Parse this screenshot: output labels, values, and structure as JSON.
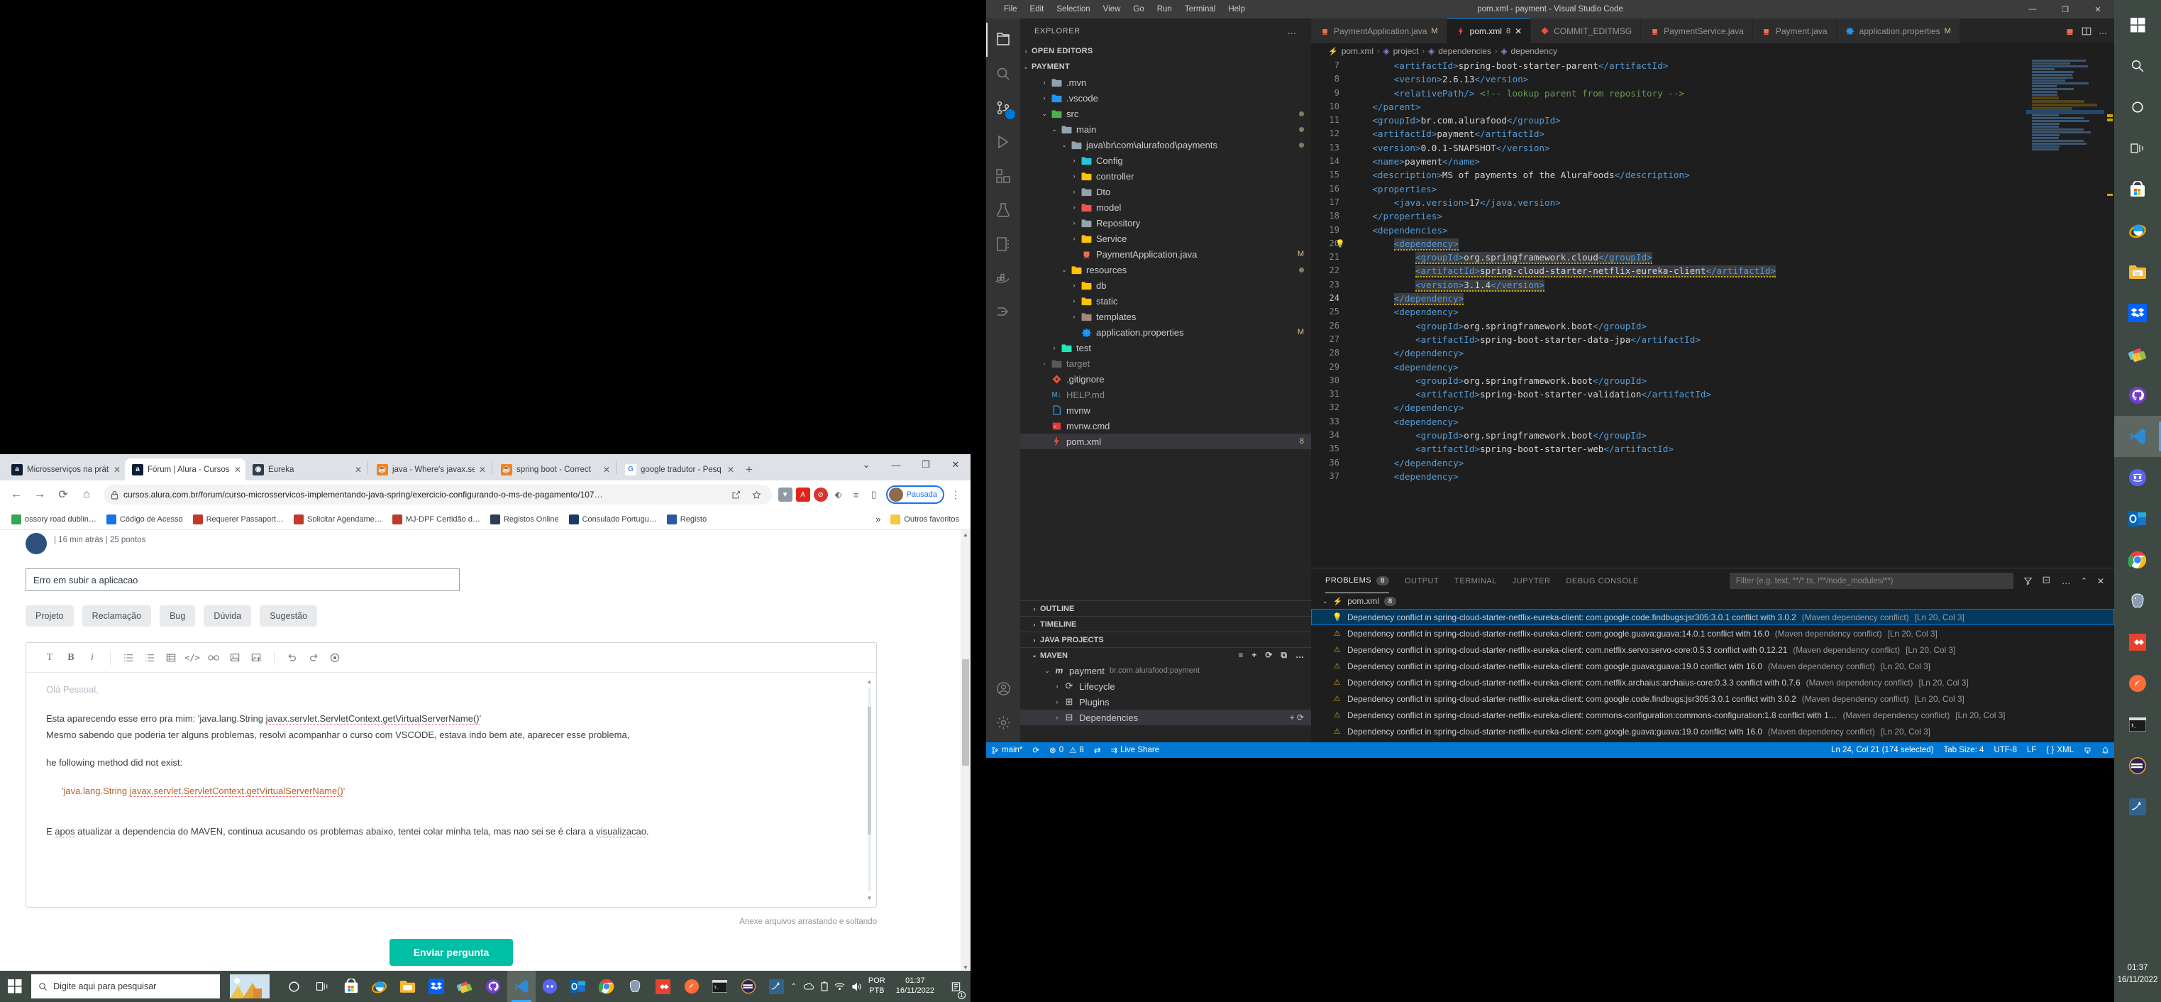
{
  "vscode": {
    "window_title": "pom.xml - payment - Visual Studio Code",
    "menu": [
      "File",
      "Edit",
      "Selection",
      "View",
      "Go",
      "Run",
      "Terminal",
      "Help"
    ],
    "window_controls": {
      "minimize": "—",
      "maximize": "❐",
      "close": "✕"
    },
    "sidebar": {
      "header": "EXPLORER",
      "header_more": "…",
      "open_editors": "OPEN EDITORS",
      "project_name": "PAYMENT",
      "tree": [
        {
          "label": ".mvn",
          "depth": 1,
          "arrow": "›",
          "icon": "folder",
          "color": "#90a4ae",
          "badge": ""
        },
        {
          "label": ".vscode",
          "depth": 1,
          "arrow": "›",
          "icon": "folder-vscode",
          "color": "#2196f3",
          "badge": ""
        },
        {
          "label": "src",
          "depth": 1,
          "arrow": "⌄",
          "icon": "folder-src",
          "color": "#4caf50",
          "badge": "dot"
        },
        {
          "label": "main",
          "depth": 2,
          "arrow": "⌄",
          "icon": "folder-open",
          "color": "#90a4ae",
          "badge": "dot"
        },
        {
          "label": "java\\br\\com\\alurafood\\payments",
          "depth": 3,
          "arrow": "⌄",
          "icon": "folder-open",
          "color": "#90a4ae",
          "badge": "dot"
        },
        {
          "label": "Config",
          "depth": 4,
          "arrow": "›",
          "icon": "folder-gear",
          "color": "#26c6da",
          "badge": ""
        },
        {
          "label": "controller",
          "depth": 4,
          "arrow": "›",
          "icon": "folder-gear",
          "color": "#ffc107",
          "badge": ""
        },
        {
          "label": "Dto",
          "depth": 4,
          "arrow": "›",
          "icon": "folder",
          "color": "#90a4ae",
          "badge": ""
        },
        {
          "label": "model",
          "depth": 4,
          "arrow": "›",
          "icon": "folder-db",
          "color": "#ef5350",
          "badge": ""
        },
        {
          "label": "Repository",
          "depth": 4,
          "arrow": "›",
          "icon": "folder",
          "color": "#90a4ae",
          "badge": ""
        },
        {
          "label": "Service",
          "depth": 4,
          "arrow": "›",
          "icon": "folder-gear",
          "color": "#ffc107",
          "badge": ""
        },
        {
          "label": "PaymentApplication.java",
          "depth": 4,
          "arrow": "",
          "icon": "java",
          "color": "#e76f51",
          "badge": "M"
        },
        {
          "label": "resources",
          "depth": 3,
          "arrow": "⌄",
          "icon": "folder-res",
          "color": "#ffc107",
          "badge": "dot"
        },
        {
          "label": "db",
          "depth": 4,
          "arrow": "›",
          "icon": "folder-res",
          "color": "#ffc107",
          "badge": ""
        },
        {
          "label": "static",
          "depth": 4,
          "arrow": "›",
          "icon": "folder-res",
          "color": "#ffc107",
          "badge": ""
        },
        {
          "label": "templates",
          "depth": 4,
          "arrow": "›",
          "icon": "folder-res",
          "color": "#a1887f",
          "badge": ""
        },
        {
          "label": "application.properties",
          "depth": 4,
          "arrow": "",
          "icon": "gear",
          "color": "#2196f3",
          "badge": "M"
        },
        {
          "label": "test",
          "depth": 2,
          "arrow": "›",
          "icon": "folder-test",
          "color": "#1de9b6",
          "badge": ""
        },
        {
          "label": "target",
          "depth": 1,
          "arrow": "›",
          "icon": "folder-dim",
          "color": "#6e7b82",
          "badge": ""
        },
        {
          "label": ".gitignore",
          "depth": 1,
          "arrow": "",
          "icon": "git",
          "color": "#f05033",
          "badge": ""
        },
        {
          "label": "HELP.md",
          "depth": 1,
          "arrow": "",
          "icon": "md",
          "color": "#4fc3f7",
          "badge": ""
        },
        {
          "label": "mvnw",
          "depth": 1,
          "arrow": "",
          "icon": "file",
          "color": "#42a5f5",
          "badge": ""
        },
        {
          "label": "mvnw.cmd",
          "depth": 1,
          "arrow": "",
          "icon": "cmd",
          "color": "#e53935",
          "badge": ""
        },
        {
          "label": "pom.xml",
          "depth": 1,
          "arrow": "",
          "icon": "pom",
          "color": "#e74c3c",
          "badge": "8",
          "selected": true
        }
      ],
      "sections": [
        {
          "label": "OUTLINE",
          "arrow": "›"
        },
        {
          "label": "TIMELINE",
          "arrow": "›"
        },
        {
          "label": "JAVA PROJECTS",
          "arrow": "›"
        },
        {
          "label": "MAVEN",
          "arrow": "⌄"
        }
      ],
      "maven": {
        "project": "payment",
        "coords": "br.com.alurafood:payment",
        "children": [
          "Lifecycle",
          "Plugins",
          "Dependencies"
        ]
      }
    },
    "tabs": [
      {
        "label": "PaymentApplication.java",
        "icon": "java",
        "modified": "M",
        "active": false
      },
      {
        "label": "pom.xml",
        "icon": "pom",
        "count": "8",
        "active": true,
        "close": "✕"
      },
      {
        "label": "COMMIT_EDITMSG",
        "icon": "git",
        "active": false
      },
      {
        "label": "PaymentService.java",
        "icon": "java",
        "active": false
      },
      {
        "label": "Payment.java",
        "icon": "java",
        "active": false
      },
      {
        "label": "application.properties",
        "icon": "gear",
        "modified": "M",
        "active": false
      }
    ],
    "breadcrumb": [
      "pom.xml",
      "project",
      "dependencies",
      "dependency"
    ],
    "code_lines": [
      {
        "n": "7",
        "html": "        <span class='tg'>&lt;artifactId&gt;</span><span class='tx'>spring-boot-starter-parent</span><span class='tg'>&lt;/artifactId&gt;</span>"
      },
      {
        "n": "8",
        "html": "        <span class='tg'>&lt;version&gt;</span><span class='tx'>2.6.13</span><span class='tg'>&lt;/version&gt;</span>"
      },
      {
        "n": "9",
        "html": "        <span class='tg'>&lt;relativePath/&gt;</span> <span class='cm'>&lt;!-- lookup parent from repository --&gt;</span>"
      },
      {
        "n": "10",
        "html": "    <span class='tg'>&lt;/parent&gt;</span>"
      },
      {
        "n": "11",
        "html": "    <span class='tg'>&lt;groupId&gt;</span><span class='tx'>br.com.alurafood</span><span class='tg'>&lt;/groupId&gt;</span>"
      },
      {
        "n": "12",
        "html": "    <span class='tg'>&lt;artifactId&gt;</span><span class='tx'>payment</span><span class='tg'>&lt;/artifactId&gt;</span>"
      },
      {
        "n": "13",
        "html": "    <span class='tg'>&lt;version&gt;</span><span class='tx'>0.0.1-SNAPSHOT</span><span class='tg'>&lt;/version&gt;</span>"
      },
      {
        "n": "14",
        "html": "    <span class='tg'>&lt;name&gt;</span><span class='tx'>payment</span><span class='tg'>&lt;/name&gt;</span>"
      },
      {
        "n": "15",
        "html": "    <span class='tg'>&lt;description&gt;</span><span class='tx'>MS of payments of the AluraFoods</span><span class='tg'>&lt;/description&gt;</span>"
      },
      {
        "n": "16",
        "html": "    <span class='tg'>&lt;properties&gt;</span>"
      },
      {
        "n": "17",
        "html": "        <span class='tg'>&lt;java.version&gt;</span><span class='tx'>17</span><span class='tg'>&lt;/java.version&gt;</span>"
      },
      {
        "n": "18",
        "html": "    <span class='tg'>&lt;/properties&gt;</span>"
      },
      {
        "n": "19",
        "html": "    <span class='tg'>&lt;dependencies&gt;</span>"
      },
      {
        "n": "20",
        "bulb": true,
        "html": "        <span class='sel-hl squig tg'>&lt;dependency&gt;</span>"
      },
      {
        "n": "21",
        "html": "            <span class='sel-hl squig'><span class='tg'>&lt;groupId&gt;</span><span class='tx'>org.springframework.cloud</span><span class='tg'>&lt;/groupId&gt;</span></span>"
      },
      {
        "n": "22",
        "html": "            <span class='sel-hl squig'><span class='tg'>&lt;artifactId&gt;</span><span class='tx'>spring-cloud-starter-netflix-eureka-client</span><span class='tg'>&lt;/artifactId&gt;</span></span>"
      },
      {
        "n": "23",
        "html": "            <span class='sel-hl squig'><span class='tg'>&lt;version&gt;</span><span class='tx'>3.1.4</span><span class='tg'>&lt;/version&gt;</span></span>"
      },
      {
        "n": "24",
        "cur": true,
        "html": "        <span class='sel-hl squig tg'>&lt;/dependency&gt;</span>"
      },
      {
        "n": "25",
        "html": "        <span class='tg'>&lt;dependency&gt;</span>"
      },
      {
        "n": "26",
        "html": "            <span class='tg'>&lt;groupId&gt;</span><span class='tx'>org.springframework.boot</span><span class='tg'>&lt;/groupId&gt;</span>"
      },
      {
        "n": "27",
        "html": "            <span class='tg'>&lt;artifactId&gt;</span><span class='tx'>spring-boot-starter-data-jpa</span><span class='tg'>&lt;/artifactId&gt;</span>"
      },
      {
        "n": "28",
        "html": "        <span class='tg'>&lt;/dependency&gt;</span>"
      },
      {
        "n": "29",
        "html": "        <span class='tg'>&lt;dependency&gt;</span>"
      },
      {
        "n": "30",
        "html": "            <span class='tg'>&lt;groupId&gt;</span><span class='tx'>org.springframework.boot</span><span class='tg'>&lt;/groupId&gt;</span>"
      },
      {
        "n": "31",
        "html": "            <span class='tg'>&lt;artifactId&gt;</span><span class='tx'>spring-boot-starter-validation</span><span class='tg'>&lt;/artifactId&gt;</span>"
      },
      {
        "n": "32",
        "html": "        <span class='tg'>&lt;/dependency&gt;</span>"
      },
      {
        "n": "33",
        "html": "        <span class='tg'>&lt;dependency&gt;</span>"
      },
      {
        "n": "34",
        "html": "            <span class='tg'>&lt;groupId&gt;</span><span class='tx'>org.springframework.boot</span><span class='tg'>&lt;/groupId&gt;</span>"
      },
      {
        "n": "35",
        "html": "            <span class='tg'>&lt;artifactId&gt;</span><span class='tx'>spring-boot-starter-web</span><span class='tg'>&lt;/artifactId&gt;</span>"
      },
      {
        "n": "36",
        "html": "        <span class='tg'>&lt;/dependency&gt;</span>"
      },
      {
        "n": "37",
        "html": "        <span class='tg'>&lt;dependency&gt;</span>"
      }
    ],
    "panel": {
      "tabs": [
        {
          "label": "PROBLEMS",
          "count": "8",
          "active": true
        },
        {
          "label": "OUTPUT",
          "active": false
        },
        {
          "label": "TERMINAL",
          "active": false
        },
        {
          "label": "JUPYTER",
          "active": false
        },
        {
          "label": "DEBUG CONSOLE",
          "active": false
        }
      ],
      "filter_placeholder": "Filter (e.g. text, **/*.ts, !**/node_modules/**)",
      "file_group": {
        "name": "pom.xml",
        "count": "8",
        "arrow": "⌄"
      },
      "problems": [
        {
          "sev": "bulb",
          "text": "Dependency conflict in spring-cloud-starter-netflix-eureka-client: com.google.code.findbugs:jsr305:3.0.1 conflict with 3.0.2",
          "src": "(Maven dependency conflict)",
          "loc": "[Ln 20, Col 3]",
          "selected": true
        },
        {
          "sev": "warning",
          "text": "Dependency conflict in spring-cloud-starter-netflix-eureka-client: com.google.guava:guava:14.0.1 conflict with 16.0",
          "src": "(Maven dependency conflict)",
          "loc": "[Ln 20, Col 3]"
        },
        {
          "sev": "warning",
          "text": "Dependency conflict in spring-cloud-starter-netflix-eureka-client: com.netflix.servo:servo-core:0.5.3 conflict with 0.12.21",
          "src": "(Maven dependency conflict)",
          "loc": "[Ln 20, Col 3]"
        },
        {
          "sev": "warning",
          "text": "Dependency conflict in spring-cloud-starter-netflix-eureka-client: com.google.guava:guava:19.0 conflict with 16.0",
          "src": "(Maven dependency conflict)",
          "loc": "[Ln 20, Col 3]"
        },
        {
          "sev": "warning",
          "text": "Dependency conflict in spring-cloud-starter-netflix-eureka-client: com.netflix.archaius:archaius-core:0.3.3 conflict with 0.7.6",
          "src": "(Maven dependency conflict)",
          "loc": "[Ln 20, Col 3]"
        },
        {
          "sev": "warning",
          "text": "Dependency conflict in spring-cloud-starter-netflix-eureka-client: com.google.code.findbugs:jsr305:3.0.1 conflict with 3.0.2",
          "src": "(Maven dependency conflict)",
          "loc": "[Ln 20, Col 3]"
        },
        {
          "sev": "warning",
          "text": "Dependency conflict in spring-cloud-starter-netflix-eureka-client: commons-configuration:commons-configuration:1.8 conflict with 1…",
          "src": "(Maven dependency conflict)",
          "loc": "[Ln 20, Col 3]"
        },
        {
          "sev": "warning",
          "text": "Dependency conflict in spring-cloud-starter-netflix-eureka-client: com.google.guava:guava:19.0 conflict with 16.0",
          "src": "(Maven dependency conflict)",
          "loc": "[Ln 20, Col 3]"
        }
      ]
    },
    "status_bar": {
      "branch": "main*",
      "sync": "⟳",
      "errors": "0",
      "warnings": "8",
      "ports": "⇄",
      "live_share": "Live Share",
      "cursor": "Ln 24, Col 21 (174 selected)",
      "tab_size": "Tab Size: 4",
      "encoding": "UTF-8",
      "eol": "LF",
      "language": "XML",
      "lang_icon": "{ }",
      "bell": "🔔"
    }
  },
  "chrome": {
    "tabs": [
      {
        "title": "Microsserviços na prát",
        "fav": "a",
        "favbg": "#0d1f33",
        "active": false
      },
      {
        "title": "Fórum | Alura - Cursos",
        "fav": "a",
        "favbg": "#0d1f33",
        "active": true
      },
      {
        "title": "Eureka",
        "fav": "◉",
        "favbg": "#2c3e50",
        "active": false
      },
      {
        "title": "java - Where's javax.se",
        "fav": "☕",
        "favbg": "#f58219",
        "active": false
      },
      {
        "title": "spring boot - Correct",
        "fav": "☕",
        "favbg": "#f58219",
        "active": false
      },
      {
        "title": "google tradutor - Pesq",
        "fav": "G",
        "favbg": "#ffffff",
        "active": false
      }
    ],
    "new_tab": "+",
    "window_controls": {
      "restore_down": "⌄",
      "minimize": "—",
      "maximize": "❐",
      "close": "✕"
    },
    "nav": {
      "back": "←",
      "forward": "→",
      "reload": "⟳",
      "home": "⌂"
    },
    "url": "cursos.alura.com.br/forum/curso-microsservicos-implementando-java-spring/exercicio-configurando-o-ms-de-pagamento/107…",
    "lock_icon": "🔒",
    "omni_actions": [
      "share-icon",
      "bookmark-star-icon"
    ],
    "extensions": [
      "pocket-icon",
      "adobe-acrobat-icon",
      "adblock-icon",
      "extension-puzzle-icon",
      "reading-list-icon",
      "sidebar-icon"
    ],
    "profile": {
      "name": "Pausada"
    },
    "menu_kebab": "⋮",
    "bookmarks": [
      {
        "label": "ossory road dublin…",
        "color": "#34a853"
      },
      {
        "label": "Código de Acesso",
        "color": "#1a73e8"
      },
      {
        "label": "Requerer Passaport…",
        "color": "#c0392b"
      },
      {
        "label": "Solicitar Agendame…",
        "color": "#c0392b"
      },
      {
        "label": "MJ-DPF Certidão d…",
        "color": "#c0392b"
      },
      {
        "label": "Registos Online",
        "color": "#2c3e50"
      },
      {
        "label": "Consulado Portugu…",
        "color": "#1b3a63"
      },
      {
        "label": "Registo",
        "color": "#2c5aa0"
      }
    ],
    "bookmarks_overflow": "»",
    "other_bookmarks": "Outros favoritos"
  },
  "forum": {
    "author": "",
    "meta": "| 16 min atrás | 25 pontos",
    "title_value": "Erro em subir a aplicacao",
    "categories": [
      "Projeto",
      "Reclamação",
      "Bug",
      "Dúvida",
      "Sugestão"
    ],
    "toolbar_icons": [
      "text-format-icon",
      "bold-icon",
      "italic-icon",
      "ordered-list-icon",
      "bullet-list-icon",
      "table-icon",
      "code-icon",
      "link-icon",
      "image-icon",
      "image-upload-icon",
      "undo-icon",
      "redo-icon",
      "help-icon"
    ],
    "body": {
      "greeting": "Olá Pessoal,",
      "line1_pre": "Esta aparecendo esse erro pra mim: 'java.lang.String ",
      "line1_link": "javax.servlet.ServletContext.getVirtualServerName()",
      "line1_post": "'",
      "line2": "Mesmo sabendo que poderia ter alguns problemas, resolvi acompanhar o curso com VSCODE, estava indo bem ate, aparecer esse problema,",
      "line3": "he following method did not exist:",
      "code_pre": "'java.lang.String ",
      "code_link": "javax.servlet.ServletContext.getVirtualServerName()",
      "code_post": "'",
      "line4_a": "E ",
      "line4_apos": "apos",
      "line4_b": " atualizar a dependencia do MAVEN, continua acusando os problemas abaixo, tentei colar minha tela, mas nao sei se é clara a ",
      "line4_link": "visualizacao",
      "line4_end": "."
    },
    "attach_note": "Anexe arquivos arrastando e soltando",
    "submit_label": "Enviar pergunta"
  },
  "taskbar": {
    "search_placeholder": "Digite aqui para pesquisar",
    "start_icon": "windows-logo-icon",
    "icons": [
      {
        "name": "cortana-icon",
        "color": "#ffffff"
      },
      {
        "name": "task-view-icon",
        "color": "#ffffff"
      },
      {
        "name": "microsoft-store-icon",
        "color": "#ffffff"
      },
      {
        "name": "internet-explorer-icon",
        "color": "#1ba1e2"
      },
      {
        "name": "file-explorer-icon",
        "color": "#ffc107"
      },
      {
        "name": "dropbox-icon",
        "color": "#0061fe"
      },
      {
        "name": "sublime-text-icon",
        "color": "#ff9800"
      },
      {
        "name": "github-desktop-icon",
        "color": "#6e40c9"
      },
      {
        "name": "visual-studio-code-icon",
        "color": "#0078d4",
        "active": true
      },
      {
        "name": "discord-icon",
        "color": "#5865f2"
      },
      {
        "name": "outlook-icon",
        "color": "#0078d4"
      },
      {
        "name": "google-chrome-icon",
        "color": "#4285f4"
      },
      {
        "name": "postgresql-icon",
        "color": "#336791"
      },
      {
        "name": "beyond-compare-icon",
        "color": "#e8412c"
      },
      {
        "name": "postman-icon",
        "color": "#ff6c37"
      },
      {
        "name": "git-bash-icon",
        "color": "#2b2b2b"
      },
      {
        "name": "eclipse-icon",
        "color": "#2c2255"
      },
      {
        "name": "mysql-workbench-icon",
        "color": "#31648c"
      }
    ],
    "tray": {
      "lang_1": "POR",
      "lang_2": "PTB",
      "time": "01:37",
      "date": "16/11/2022",
      "notification_count": "1"
    }
  }
}
